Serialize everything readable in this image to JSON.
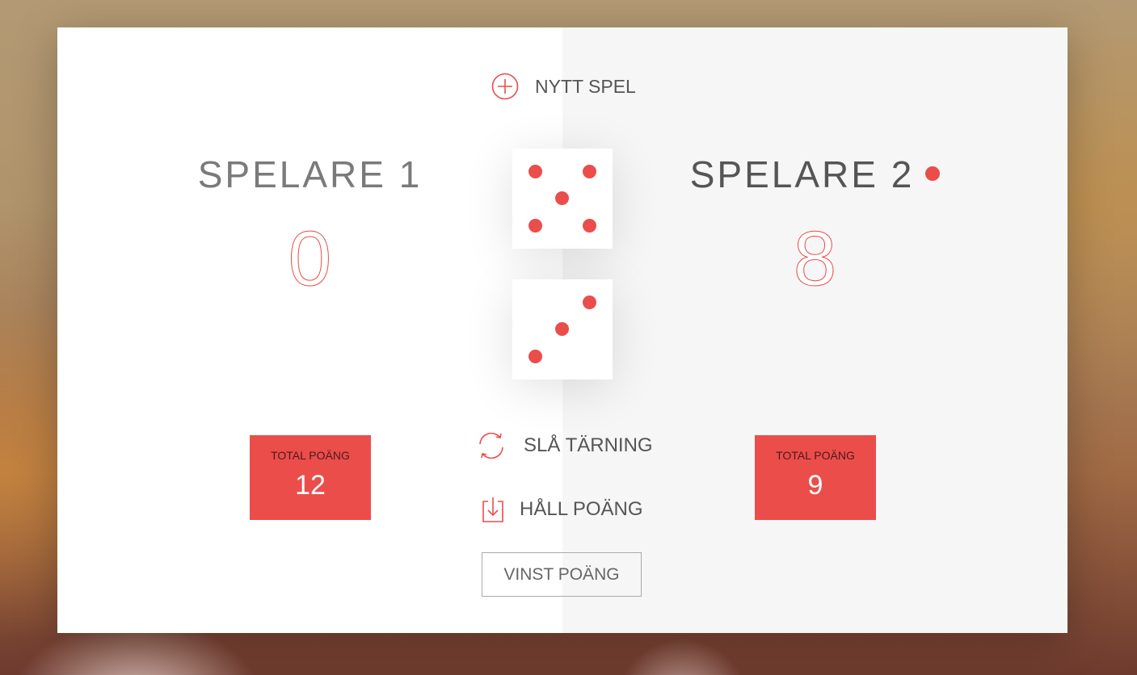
{
  "new_game": {
    "label": "NYTT SPEL",
    "icon": "plus-circle-icon"
  },
  "players": [
    {
      "name": "SPELARE 1",
      "current": "0",
      "total_label": "TOTAL POÄNG",
      "total": "12",
      "active": false
    },
    {
      "name": "SPELARE 2",
      "current": "8",
      "total_label": "TOTAL POÄNG",
      "total": "9",
      "active": true
    }
  ],
  "dice": [
    5,
    3
  ],
  "actions": {
    "roll": {
      "label": "SLÅ TÄRNING",
      "icon": "refresh-icon"
    },
    "hold": {
      "label": "HÅLL POÄNG",
      "icon": "download-icon"
    }
  },
  "winning_score": {
    "placeholder": "VINST POÄNG",
    "value": ""
  },
  "colors": {
    "accent": "#eb4d4b",
    "left_panel": "#ffffff",
    "right_panel": "#f6f6f6"
  }
}
